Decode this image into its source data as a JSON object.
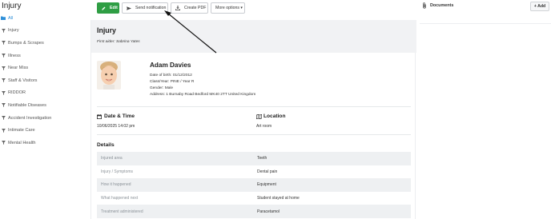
{
  "page": {
    "title": "Injury"
  },
  "sidebar": {
    "items": [
      {
        "label": "All",
        "icon": "folder-icon",
        "active": true
      },
      {
        "label": "Injury",
        "icon": "filter-icon"
      },
      {
        "label": "Bumps & Scrapes",
        "icon": "filter-icon"
      },
      {
        "label": "Illness",
        "icon": "filter-icon"
      },
      {
        "label": "Near Miss",
        "icon": "filter-icon"
      },
      {
        "label": "Staff & Visitors",
        "icon": "filter-icon"
      },
      {
        "label": "RIDDOR",
        "icon": "filter-icon"
      },
      {
        "label": "Notifiable Diseases",
        "icon": "filter-icon"
      },
      {
        "label": "Accident Investigation",
        "icon": "filter-icon"
      },
      {
        "label": "Intimate Care",
        "icon": "filter-icon"
      },
      {
        "label": "Mental Health",
        "icon": "filter-icon"
      }
    ]
  },
  "toolbar": {
    "edit_label": "Edit",
    "send_label": "Send notification",
    "pdf_label": "Create PDF",
    "more_label": "More options ▾"
  },
  "incident": {
    "title": "Injury",
    "first_aider": "First aider: Sabrina Yates"
  },
  "person": {
    "name": "Adam Davies",
    "dob_label": "Date of birth:",
    "dob": "01/12/2012",
    "class_label": "Class/Year:",
    "class": "PINE / Year R",
    "gender_label": "Gender:",
    "gender": "Male",
    "address_label": "Address:",
    "address": "1 Burnaby Road Bedford MK40 2TT United Kingdom"
  },
  "datetime": {
    "heading": "Date & Time",
    "value": "10/06/2025 14:02 pm"
  },
  "location": {
    "heading": "Location",
    "value": "Art room"
  },
  "details": {
    "heading": "Details",
    "rows": [
      {
        "label": "Injured area",
        "value": "Teeth"
      },
      {
        "label": "Injury / Symptoms",
        "value": "Dental pain"
      },
      {
        "label": "How it happened",
        "value": "Equipment"
      },
      {
        "label": "What happened next",
        "value": "Student stayed at home"
      },
      {
        "label": "Treatment administered",
        "value": "Paracetamol"
      }
    ]
  },
  "documents": {
    "title": "Documents",
    "add_label": "+ Add"
  },
  "colors": {
    "accent": "#2f8fd8",
    "edit_button": "#2f9e44",
    "header_band": "#f1f2f4",
    "row_stripe": "#eef0f2"
  }
}
